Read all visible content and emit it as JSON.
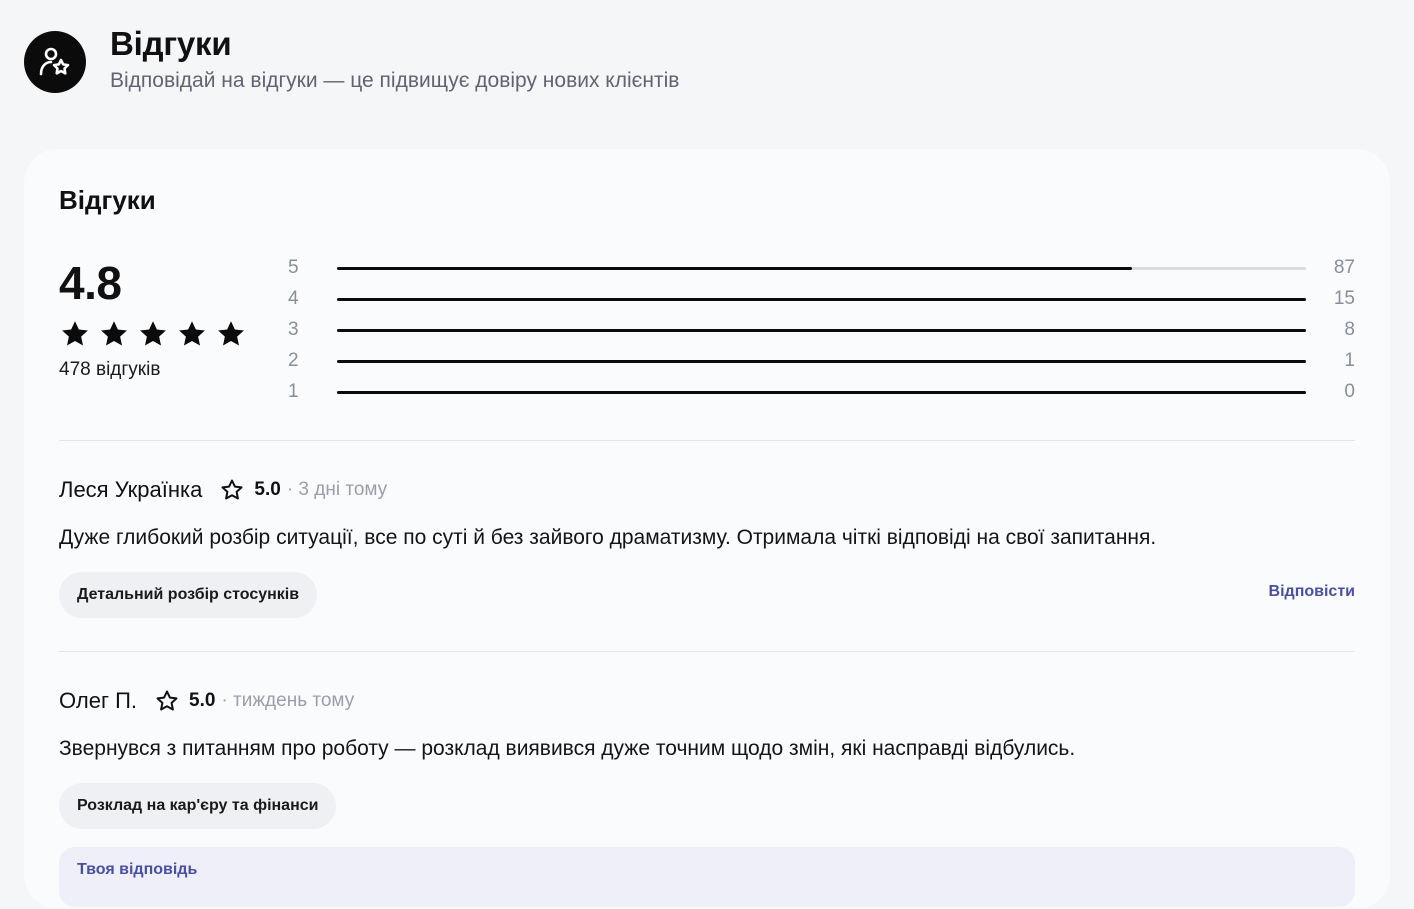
{
  "header": {
    "title": "Відгуки",
    "subtitle": "Відповідай на відгуки — це підвищує довіру нових клієнтів",
    "icon": "user-star-icon"
  },
  "card": {
    "title": "Відгуки",
    "summary": {
      "average": "4.8",
      "stars_filled": 5,
      "count_label": "478 відгуків"
    },
    "distribution": [
      {
        "stars": "5",
        "count": "87",
        "fill": 0.82
      },
      {
        "stars": "4",
        "count": "15",
        "fill": 1.0
      },
      {
        "stars": "3",
        "count": "8",
        "fill": 1.0
      },
      {
        "stars": "2",
        "count": "1",
        "fill": 1.0
      },
      {
        "stars": "1",
        "count": "0",
        "fill": 1.0
      }
    ]
  },
  "reviews": [
    {
      "name": "Леся Українка",
      "score": "5.0",
      "time": "· 3 дні тому",
      "text": "Дуже глибокий розбір ситуації, все по суті й без зайвого драматизму. Отримала чіткі відповіді на свої запитання.",
      "tag": "Детальний розбір стосунків",
      "reply_label": "Відповісти"
    },
    {
      "name": "Олег П.",
      "score": "5.0",
      "time": "· тиждень тому",
      "text": "Звернувся з питанням про роботу — розклад виявився дуже точним щодо змін, які насправді відбулись.",
      "tag": "Розклад на кар'єру та фінанси",
      "reply_box_label": "Твоя відповідь"
    }
  ],
  "colors": {
    "accent": "#4a4fa0",
    "bar": "#0b0b0b",
    "track": "#d9dbe0",
    "muted": "#8a8e98"
  }
}
